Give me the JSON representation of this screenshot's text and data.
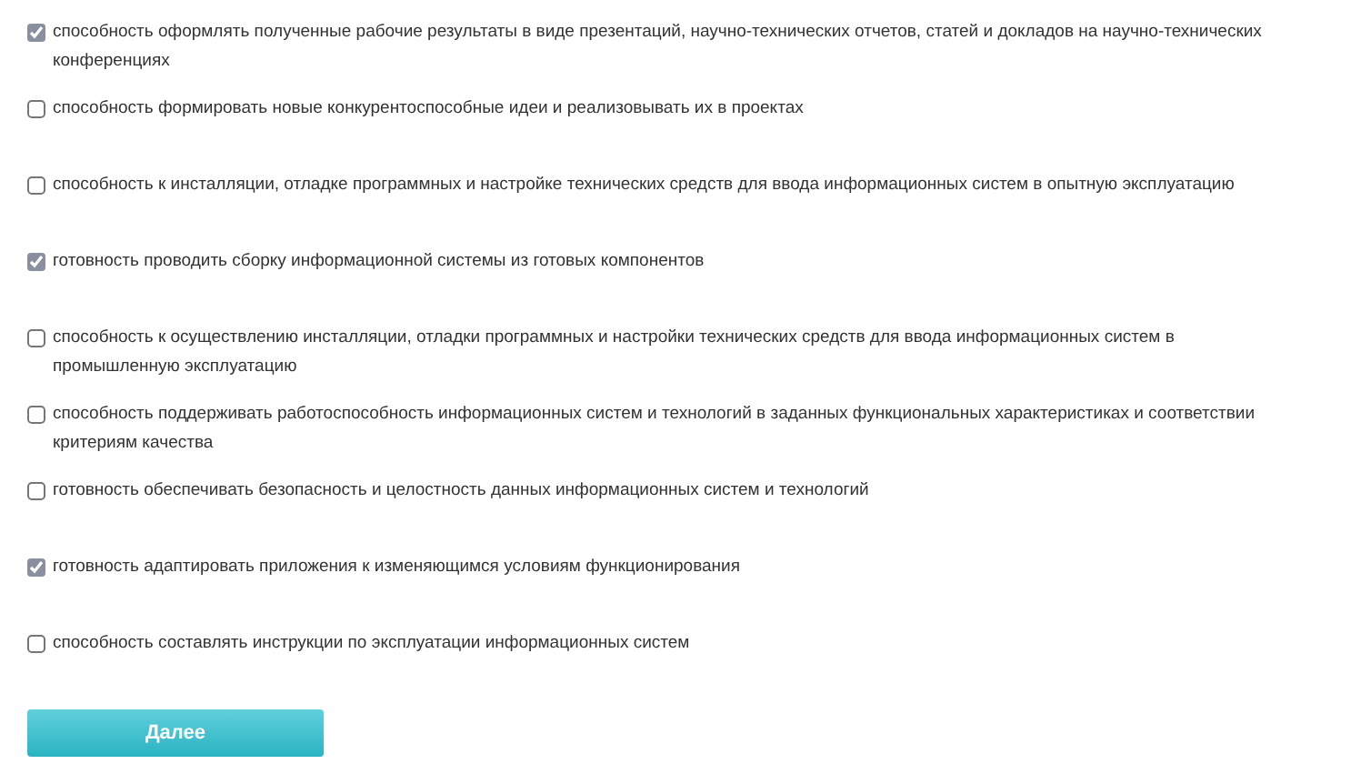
{
  "options": [
    {
      "label": "способность оформлять полученные рабочие результаты в виде презентаций, научно-технических отчетов, статей и докладов на научно-технических конференциях",
      "checked": true
    },
    {
      "label": "способность формировать новые конкурентоспособные идеи и реализовывать их в проектах",
      "checked": false
    },
    {
      "label": "способность к инсталляции, отладке программных и настройке технических средств для ввода информационных систем в опытную эксплуатацию",
      "checked": false
    },
    {
      "label": "готовность проводить сборку информационной системы из готовых компонентов",
      "checked": true
    },
    {
      "label": "способность к осуществлению инсталляции, отладки программных и настройки технических средств для ввода информационных систем в промышленную эксплуатацию",
      "checked": false
    },
    {
      "label": "способность поддерживать работоспособность информационных систем и технологий в заданных функциональных характеристиках и соответствии критериям качества",
      "checked": false
    },
    {
      "label": "готовность обеспечивать безопасность и целостность данных информационных систем и технологий",
      "checked": false
    },
    {
      "label": "готовность адаптировать приложения к изменяющимся условиям функционирования",
      "checked": true
    },
    {
      "label": "способность составлять инструкции по эксплуатации информационных систем",
      "checked": false
    }
  ],
  "next_button": "Далее"
}
